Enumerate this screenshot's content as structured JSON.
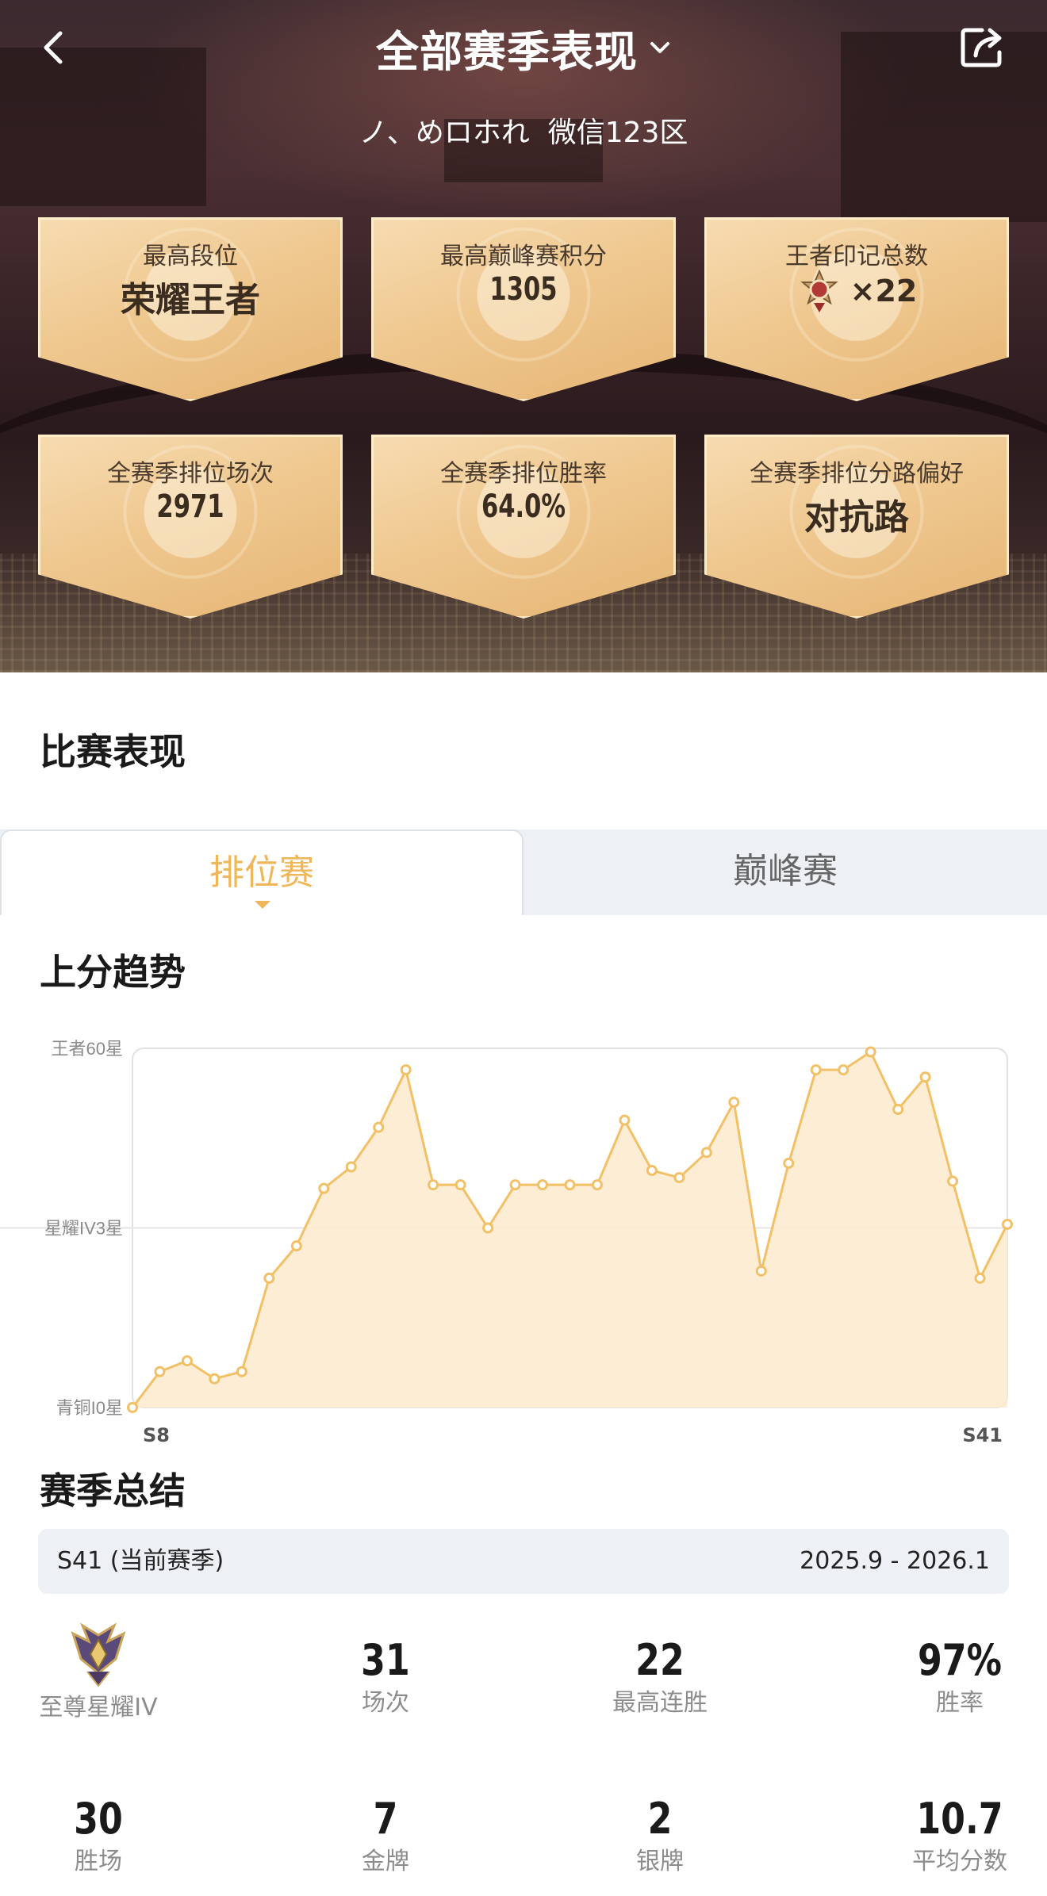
{
  "header": {
    "title": "全部赛季表现",
    "player_line": "ノ、めロホれ  微信123区"
  },
  "cards": [
    {
      "label": "最高段位",
      "value": "荣耀王者"
    },
    {
      "label": "最高巅峰赛积分",
      "value": "1305"
    },
    {
      "label": "王者印记总数",
      "value": "×22"
    },
    {
      "label": "全赛季排位场次",
      "value": "2971"
    },
    {
      "label": "全赛季排位胜率",
      "value": "64.0%"
    },
    {
      "label": "全赛季排位分路偏好",
      "value": "对抗路"
    }
  ],
  "performance": {
    "heading": "比赛表现",
    "tabs": [
      {
        "label": "排位赛",
        "active": true
      },
      {
        "label": "巅峰赛",
        "active": false
      }
    ]
  },
  "trend": {
    "heading": "上分趋势"
  },
  "chart_data": {
    "type": "area",
    "xlabel": "",
    "ylabel": "",
    "x_tick_labels": [
      "S8",
      "S41"
    ],
    "y_tick_labels": [
      "青铜I0星",
      "星耀IV3星",
      "王者60星"
    ],
    "ylim": [
      0,
      100
    ],
    "grid": "horizontal line at 星耀IV3星",
    "colors": {
      "line": "#f2c067",
      "fill": "#fcebcf"
    },
    "series": [
      {
        "values": [
          0,
          10,
          13,
          8,
          10,
          36,
          45,
          61,
          67,
          78,
          94,
          62,
          62,
          50,
          62,
          62,
          62,
          62,
          80,
          66,
          64,
          71,
          85,
          38,
          68,
          94,
          94,
          99,
          83,
          92,
          63,
          36,
          51
        ]
      }
    ]
  },
  "summary": {
    "heading": "赛季总结",
    "season_name": "S41 (当前赛季)",
    "season_dates": "2025.9 - 2026.1",
    "rank_label": "至尊星耀IV",
    "stats_row1": [
      {
        "value": "31",
        "label": "场次"
      },
      {
        "value": "22",
        "label": "最高连胜"
      },
      {
        "value": "97%",
        "label": "胜率"
      }
    ],
    "stats_row2": [
      {
        "value": "30",
        "label": "胜场"
      },
      {
        "value": "7",
        "label": "金牌"
      },
      {
        "value": "2",
        "label": "银牌"
      },
      {
        "value": "10.7",
        "label": "平均分数"
      }
    ]
  }
}
